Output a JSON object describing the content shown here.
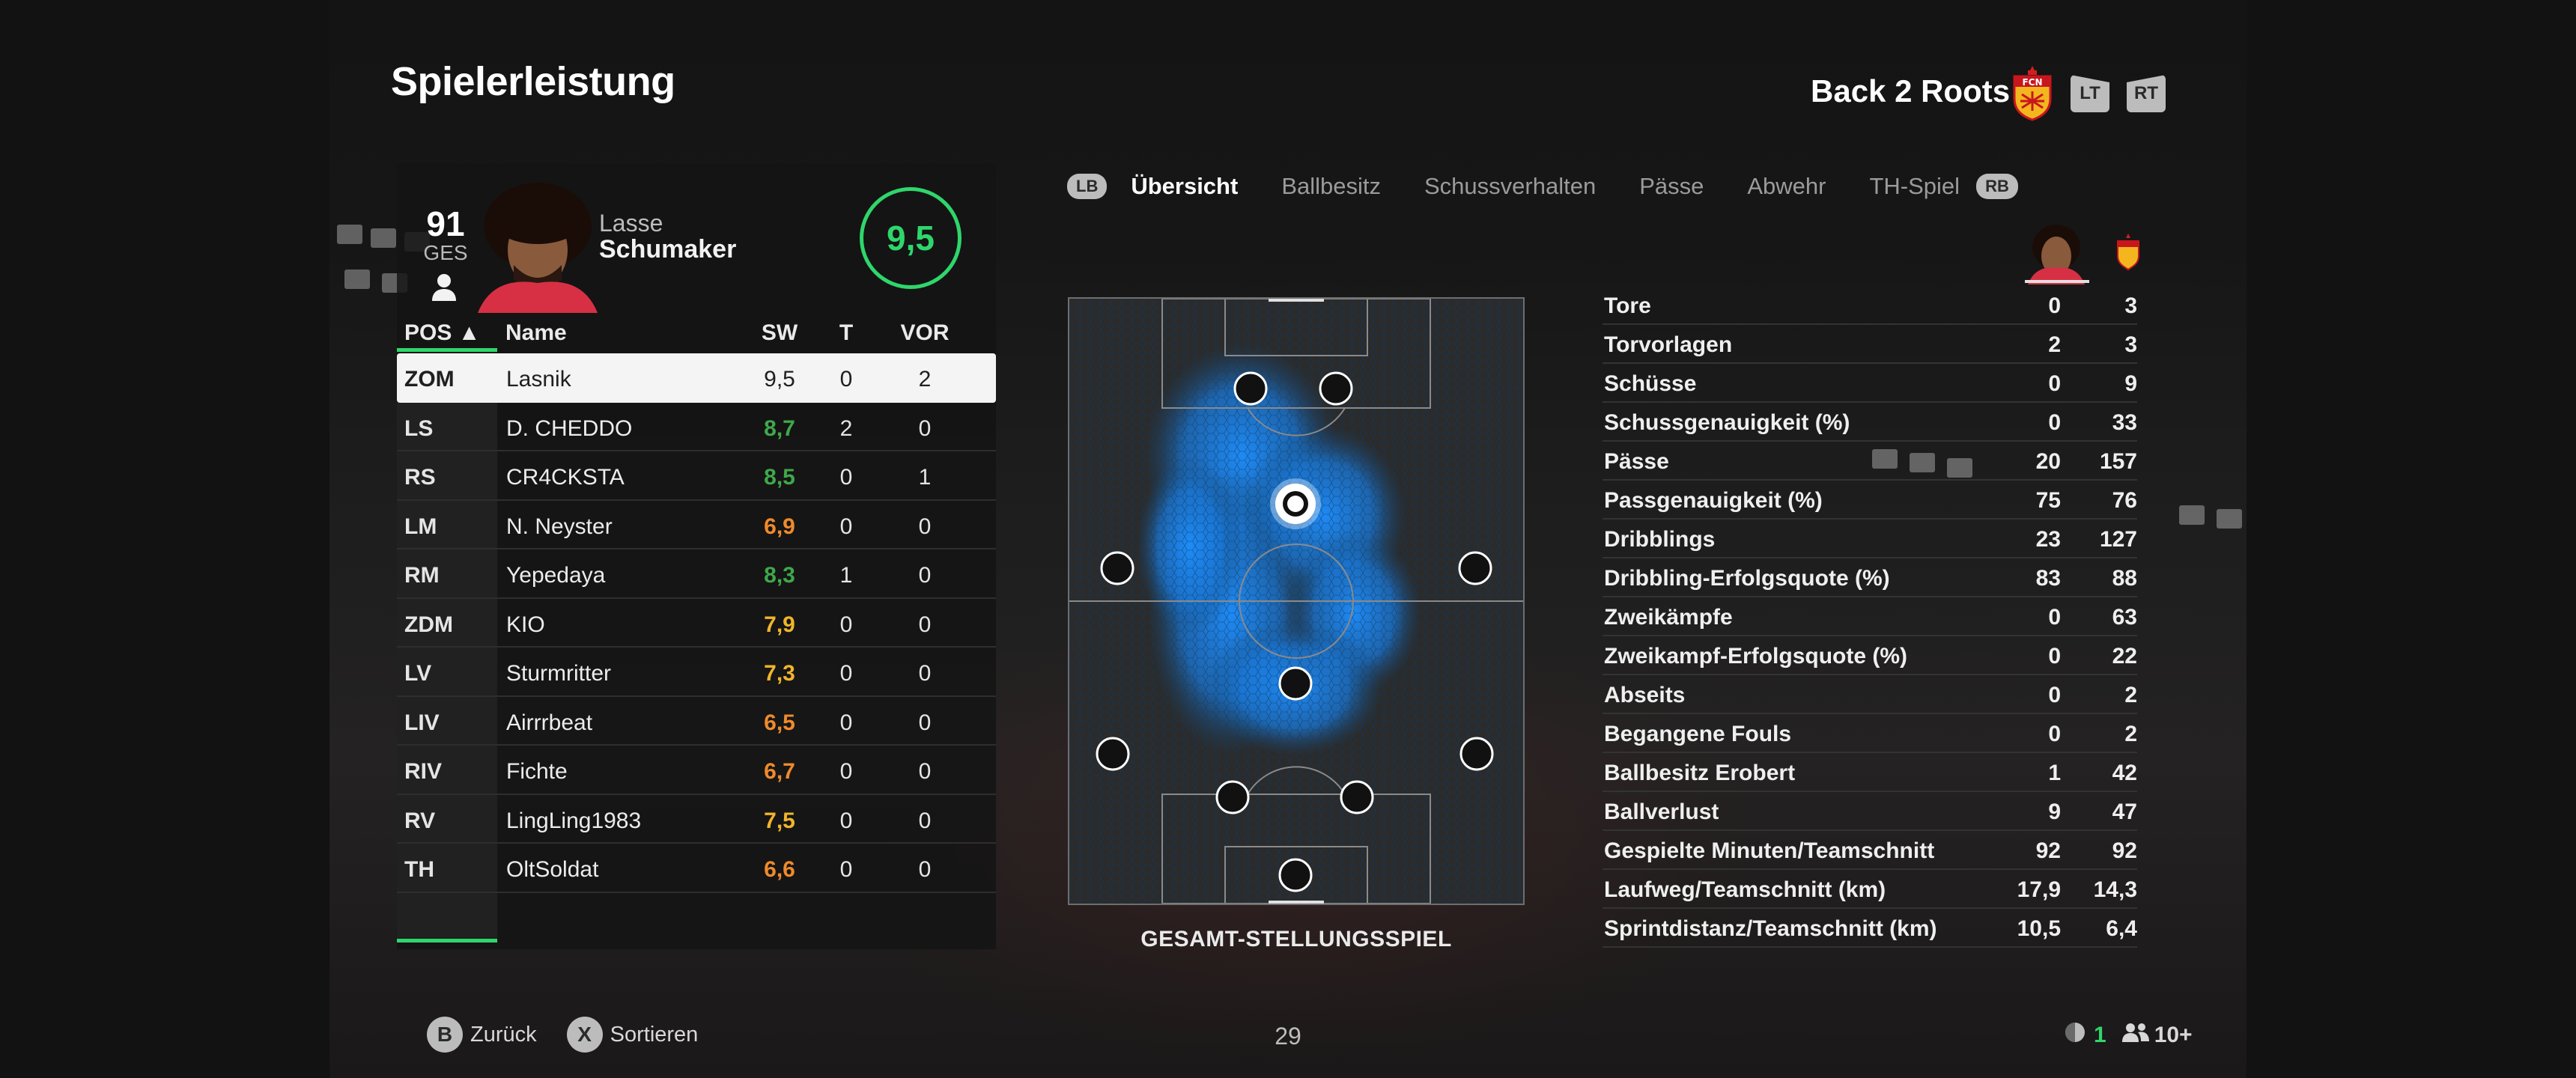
{
  "header": {
    "title": "Spielerleistung",
    "team_name": "Back 2 Roots",
    "lt_label": "LT",
    "rt_label": "RT",
    "club_badge_text": "FCN"
  },
  "player": {
    "overall": "91",
    "overall_label": "GES",
    "first_name": "Lasse",
    "last_name": "Schumaker",
    "match_rating": "9,5"
  },
  "table": {
    "headers": {
      "pos": "POS ▲",
      "name": "Name",
      "sw": "SW",
      "t": "T",
      "vor": "VOR"
    },
    "rows": [
      {
        "pos": "ZOM",
        "name": "Lasnik",
        "sw": "9,5",
        "t": "0",
        "vor": "2",
        "color": "#202020"
      },
      {
        "pos": "LS",
        "name": "D. CHEDDO",
        "sw": "8,7",
        "t": "2",
        "vor": "0",
        "color": "#3fa84a"
      },
      {
        "pos": "RS",
        "name": "CR4CKSTA",
        "sw": "8,5",
        "t": "0",
        "vor": "1",
        "color": "#3fa84a"
      },
      {
        "pos": "LM",
        "name": "N. Neyster",
        "sw": "6,9",
        "t": "0",
        "vor": "0",
        "color": "#f08a2b"
      },
      {
        "pos": "RM",
        "name": "Yepedaya",
        "sw": "8,3",
        "t": "1",
        "vor": "0",
        "color": "#3fa84a"
      },
      {
        "pos": "ZDM",
        "name": "KIO",
        "sw": "7,9",
        "t": "0",
        "vor": "0",
        "color": "#f0b52b"
      },
      {
        "pos": "LV",
        "name": "Sturmritter",
        "sw": "7,3",
        "t": "0",
        "vor": "0",
        "color": "#f0b52b"
      },
      {
        "pos": "LIV",
        "name": "Airrrbeat",
        "sw": "6,5",
        "t": "0",
        "vor": "0",
        "color": "#f08a2b"
      },
      {
        "pos": "RIV",
        "name": "Fichte",
        "sw": "6,7",
        "t": "0",
        "vor": "0",
        "color": "#f08a2b"
      },
      {
        "pos": "RV",
        "name": "LingLing1983",
        "sw": "7,5",
        "t": "0",
        "vor": "0",
        "color": "#f0b52b"
      },
      {
        "pos": "TH",
        "name": "OltSoldat",
        "sw": "6,6",
        "t": "0",
        "vor": "0",
        "color": "#f08a2b"
      }
    ]
  },
  "tabs": {
    "lb_label": "LB",
    "rb_label": "RB",
    "items": [
      "Übersicht",
      "Ballbesitz",
      "Schussverhalten",
      "Pässe",
      "Abwehr",
      "TH-Spiel"
    ],
    "active": "Übersicht"
  },
  "pitch": {
    "caption": "GESAMT-STELLUNGSSPIEL"
  },
  "stats": [
    {
      "label": "Tore",
      "player": "0",
      "team": "3"
    },
    {
      "label": "Torvorlagen",
      "player": "2",
      "team": "3"
    },
    {
      "label": "Schüsse",
      "player": "0",
      "team": "9"
    },
    {
      "label": "Schussgenauigkeit (%)",
      "player": "0",
      "team": "33"
    },
    {
      "label": "Pässe",
      "player": "20",
      "team": "157"
    },
    {
      "label": "Passgenauigkeit (%)",
      "player": "75",
      "team": "76"
    },
    {
      "label": "Dribblings",
      "player": "23",
      "team": "127"
    },
    {
      "label": "Dribbling-Erfolgsquote (%)",
      "player": "83",
      "team": "88"
    },
    {
      "label": "Zweikämpfe",
      "player": "0",
      "team": "63"
    },
    {
      "label": "Zweikampf-Erfolgsquote (%)",
      "player": "0",
      "team": "22"
    },
    {
      "label": "Abseits",
      "player": "0",
      "team": "2"
    },
    {
      "label": "Begangene Fouls",
      "player": "0",
      "team": "2"
    },
    {
      "label": "Ballbesitz Erobert",
      "player": "1",
      "team": "42"
    },
    {
      "label": "Ballverlust",
      "player": "9",
      "team": "47"
    },
    {
      "label": "Gespielte Minuten/Teamschnitt",
      "player": "92",
      "team": "92"
    },
    {
      "label": "Laufweg/Teamschnitt (km)",
      "player": "17,9",
      "team": "14,3"
    },
    {
      "label": "Sprintdistanz/Teamschnitt (km)",
      "player": "10,5",
      "team": "6,4"
    }
  ],
  "footer": {
    "back_key": "B",
    "back_label": "Zurück",
    "sort_key": "X",
    "sort_label": "Sortieren",
    "page_number": "29",
    "level_count": "1",
    "friends_count": "10+"
  },
  "colors": {
    "accent_green": "#2fd66b",
    "heatmap_blue": "#1e8fff"
  }
}
